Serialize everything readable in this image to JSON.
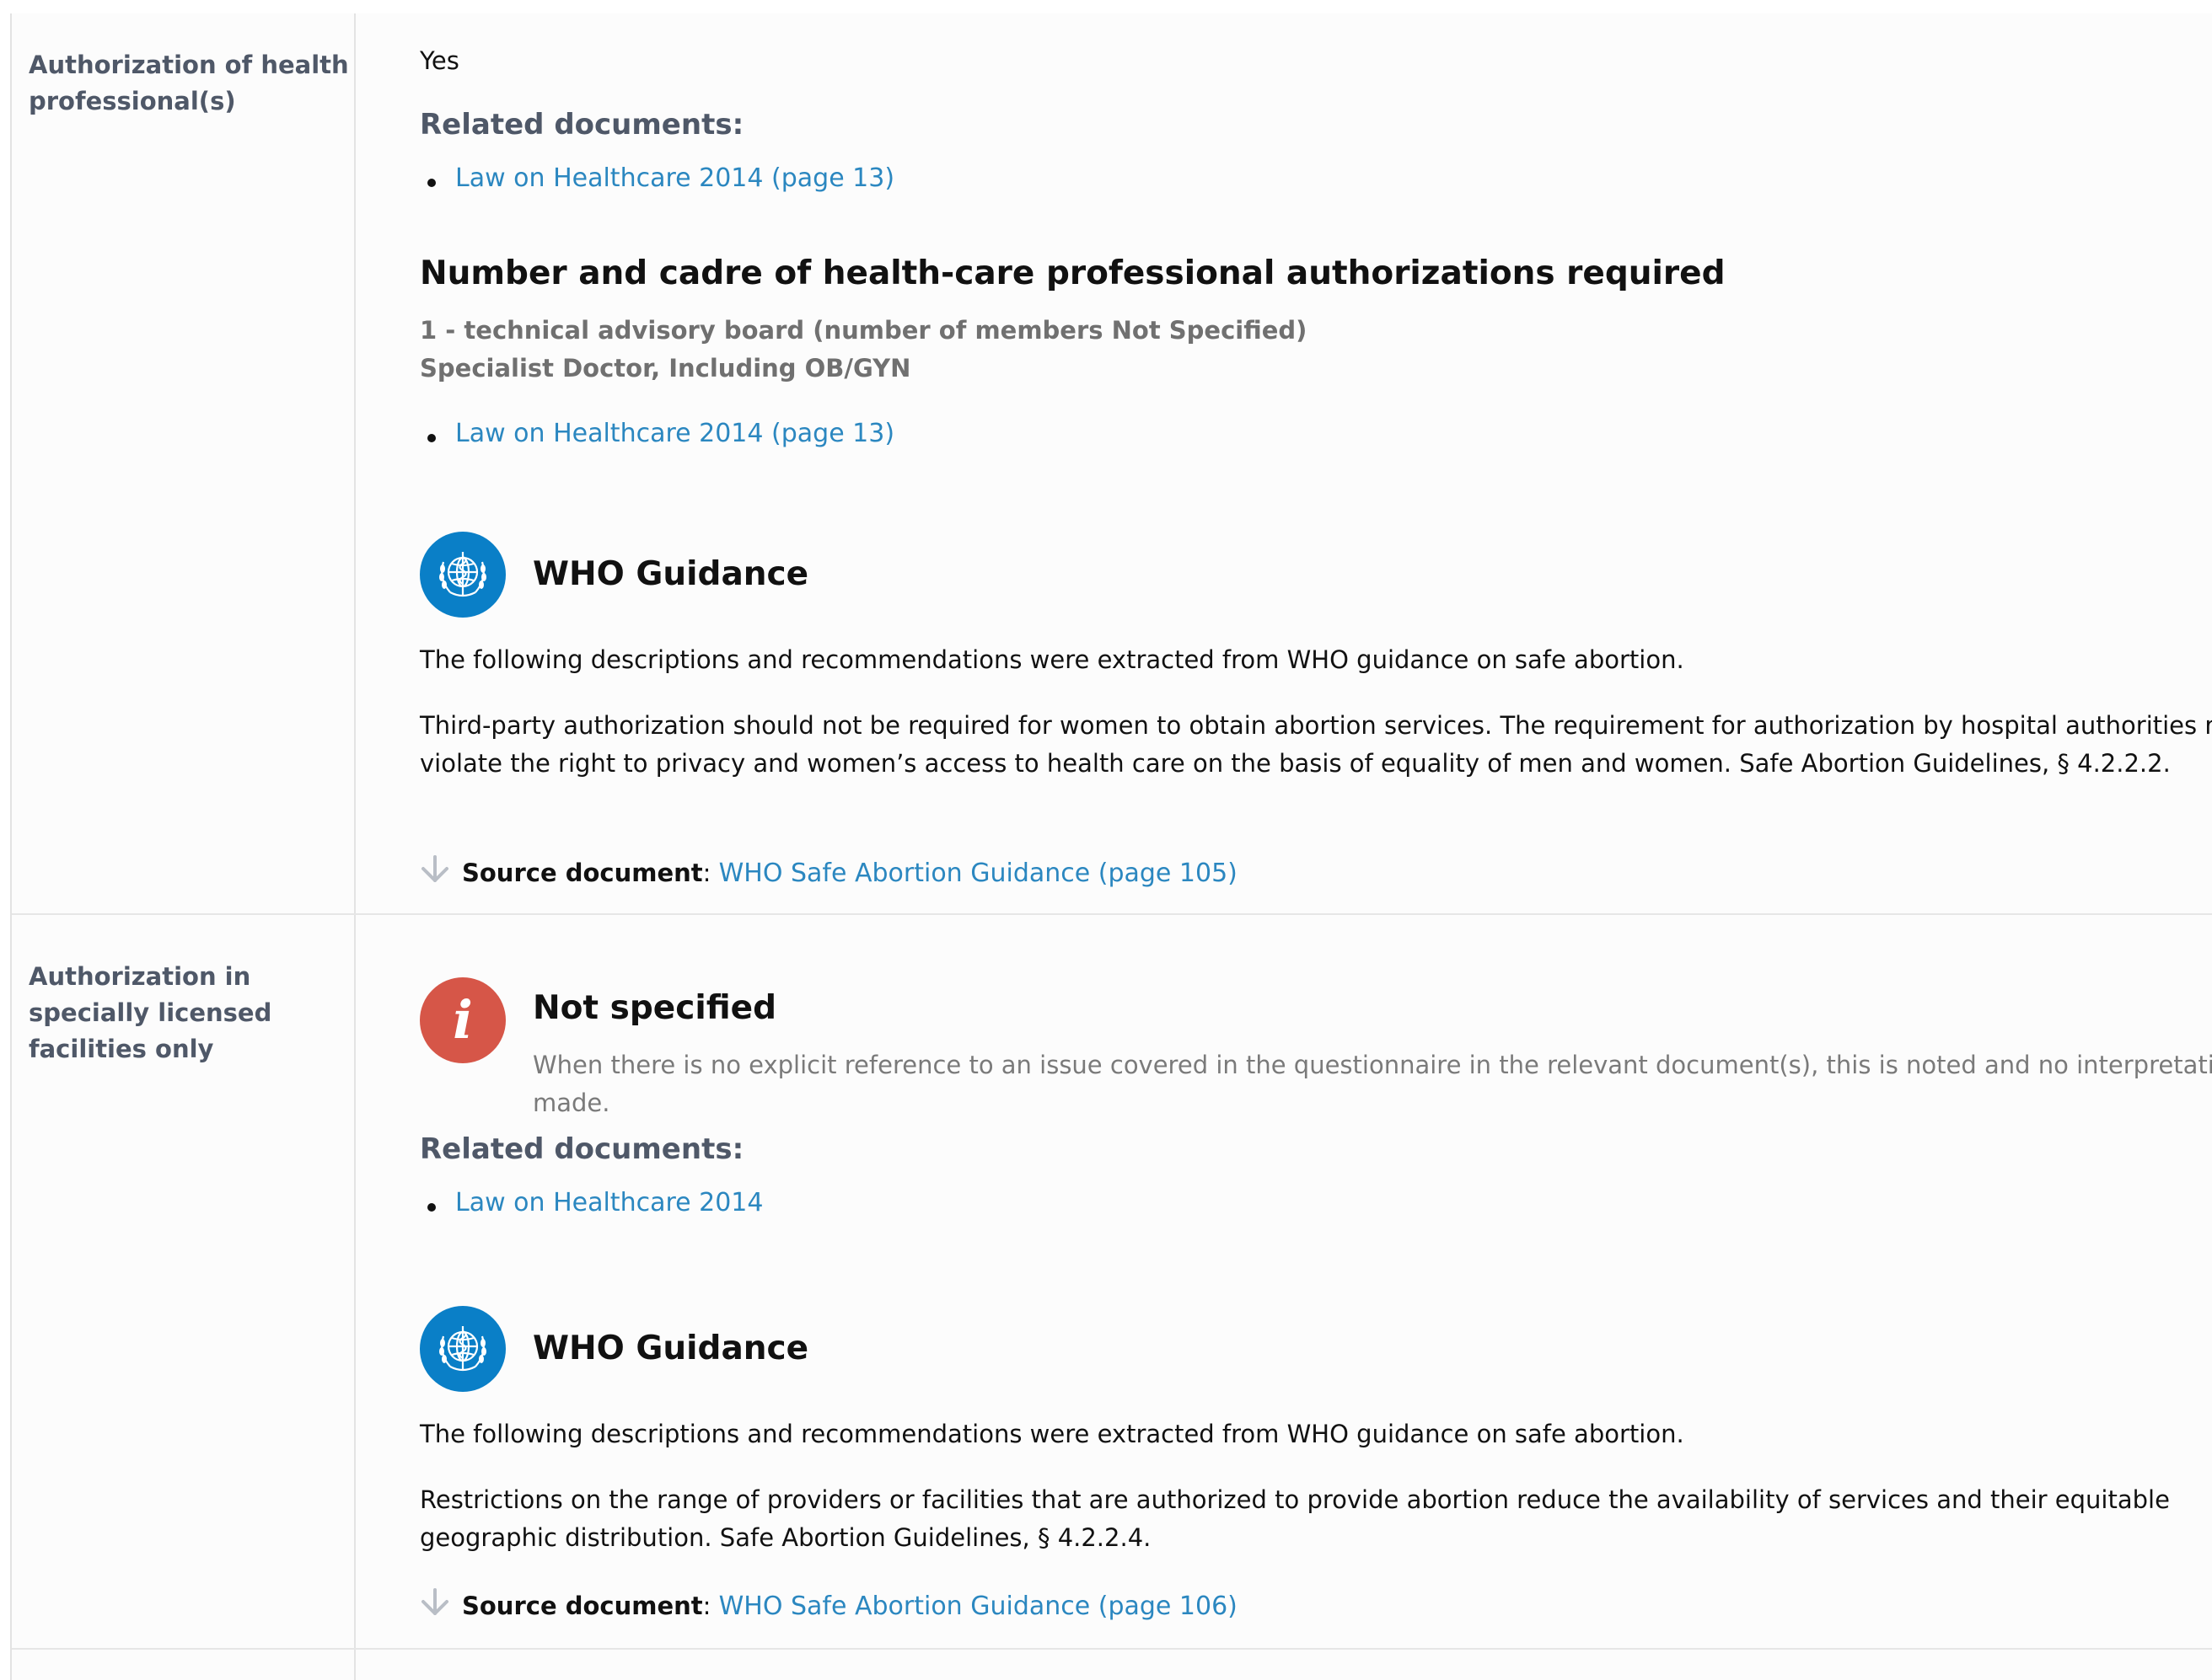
{
  "rows": [
    {
      "label": "Authorization of health professional(s)",
      "answer": "Yes",
      "related_heading": "Related documents:",
      "related_docs": [
        "Law on Healthcare 2014 (page 13)"
      ],
      "section_heading": "Number and cadre of health-care professional authorizations required",
      "details": [
        "1 - technical advisory board (number of members Not Specified)",
        "Specialist Doctor, Including OB/GYN"
      ],
      "section_docs": [
        "Law on Healthcare 2014 (page 13)"
      ],
      "who": {
        "icon": "who-emblem-icon",
        "title": "WHO Guidance",
        "intro": "The following descriptions and recommendations were extracted from WHO guidance on safe abortion.",
        "text": "Third-party authorization should not be required for women to obtain abortion services. The requirement for authorization by hospital authorities may violate the right to privacy and women’s access to health care on the basis of equality of men and women. Safe Abortion Guidelines, § 4.2.2.2.",
        "source_label": "Source document",
        "source_sep": ":",
        "source_link": "WHO Safe Abortion Guidance (page 105)"
      }
    },
    {
      "label": "Authorization in specially licensed facilities only",
      "status": {
        "icon": "info-icon",
        "glyph": "i",
        "title": "Not specified",
        "description": "When there is no explicit reference to an issue covered in the questionnaire in the relevant document(s), this is noted and no interpretation was made."
      },
      "related_heading": "Related documents:",
      "related_docs": [
        "Law on Healthcare 2014"
      ],
      "who": {
        "icon": "who-emblem-icon",
        "title": "WHO Guidance",
        "intro": "The following descriptions and recommendations were extracted from WHO guidance on safe abortion.",
        "text": "Restrictions on the range of providers or facilities that are authorized to provide abortion reduce the availability of services and their equitable geographic distribution. Safe Abortion Guidelines, § 4.2.2.4.",
        "source_label": "Source document",
        "source_sep": ":",
        "source_link": "WHO Safe Abortion Guidance (page 106)"
      }
    }
  ],
  "colors": {
    "link": "#2b87c0",
    "label": "#4f5868",
    "who_blue": "#0a7fc7",
    "info_red": "#d65648",
    "muted": "#707070"
  }
}
